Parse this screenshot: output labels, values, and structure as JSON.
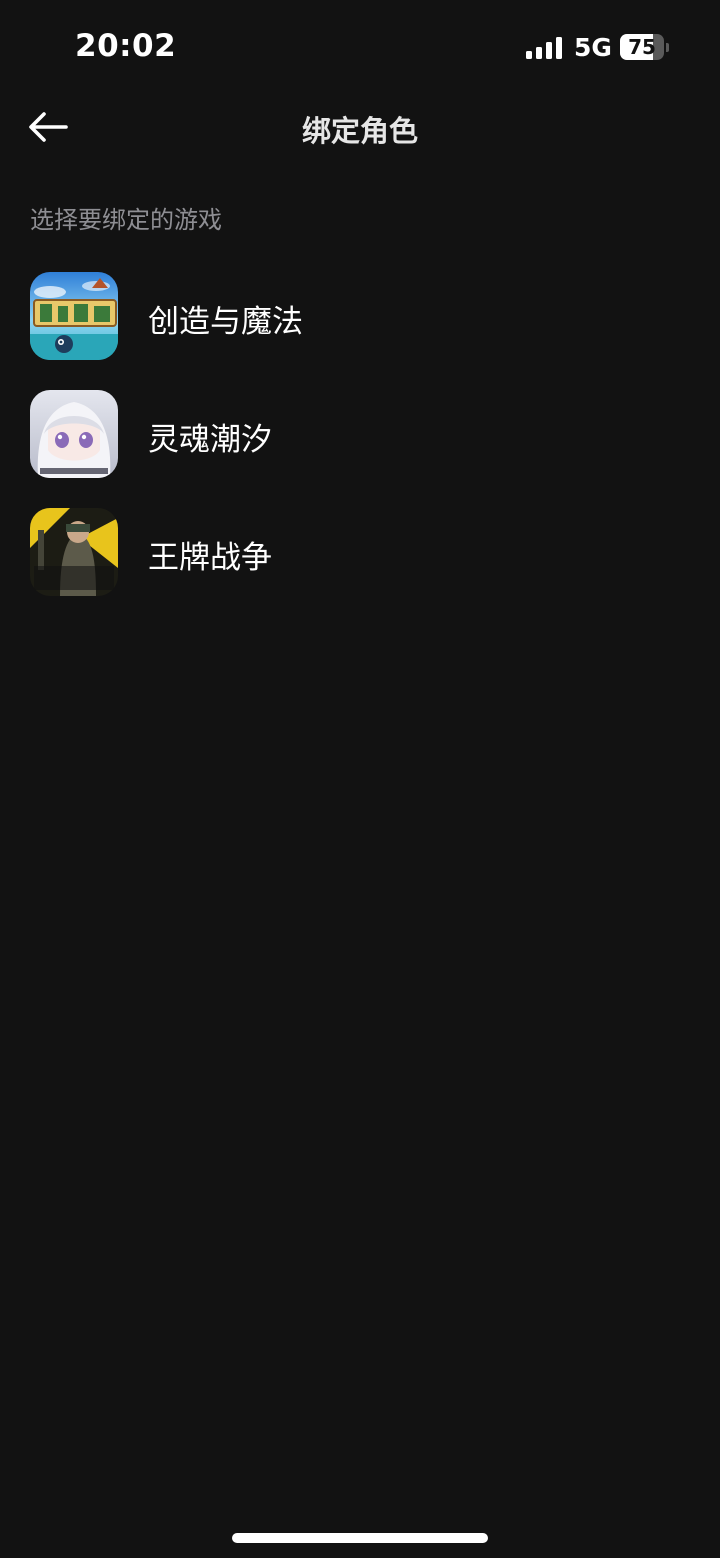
{
  "status_bar": {
    "time": "20:02",
    "network": "5G",
    "battery_level": "75",
    "battery_fraction": 0.75,
    "signal_icon": "cellular-signal-icon",
    "battery_icon": "battery-icon"
  },
  "header": {
    "back_icon": "back-arrow-icon",
    "title": "绑定角色"
  },
  "section": {
    "label": "选择要绑定的游戏"
  },
  "games": [
    {
      "name": "创造与魔法",
      "icon": "game-icon-creation-and-magic"
    },
    {
      "name": "灵魂潮汐",
      "icon": "game-icon-soul-tide"
    },
    {
      "name": "王牌战争",
      "icon": "game-icon-ace-war"
    }
  ],
  "colors": {
    "background": "#121212",
    "text_primary": "#ffffff",
    "text_secondary": "#8e8e93"
  }
}
